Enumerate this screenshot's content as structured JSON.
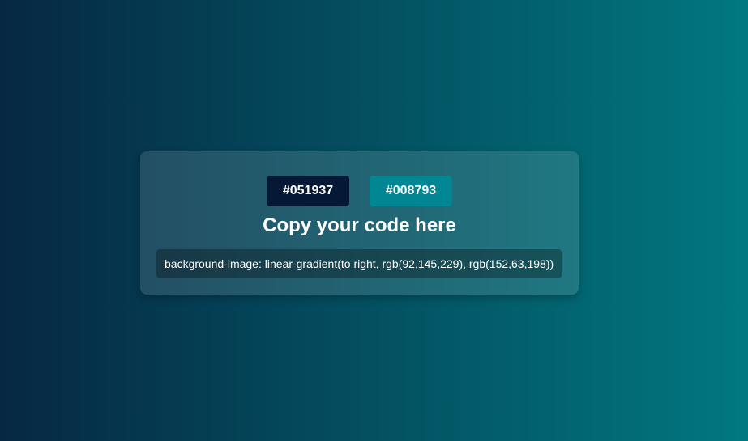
{
  "swatches": [
    {
      "label": "#051937",
      "color": "#051937"
    },
    {
      "label": "#008793",
      "color": "#008793"
    }
  ],
  "title": "Copy your code here",
  "code": "background-image: linear-gradient(to right, rgb(92,145,229), rgb(152,63,198))"
}
